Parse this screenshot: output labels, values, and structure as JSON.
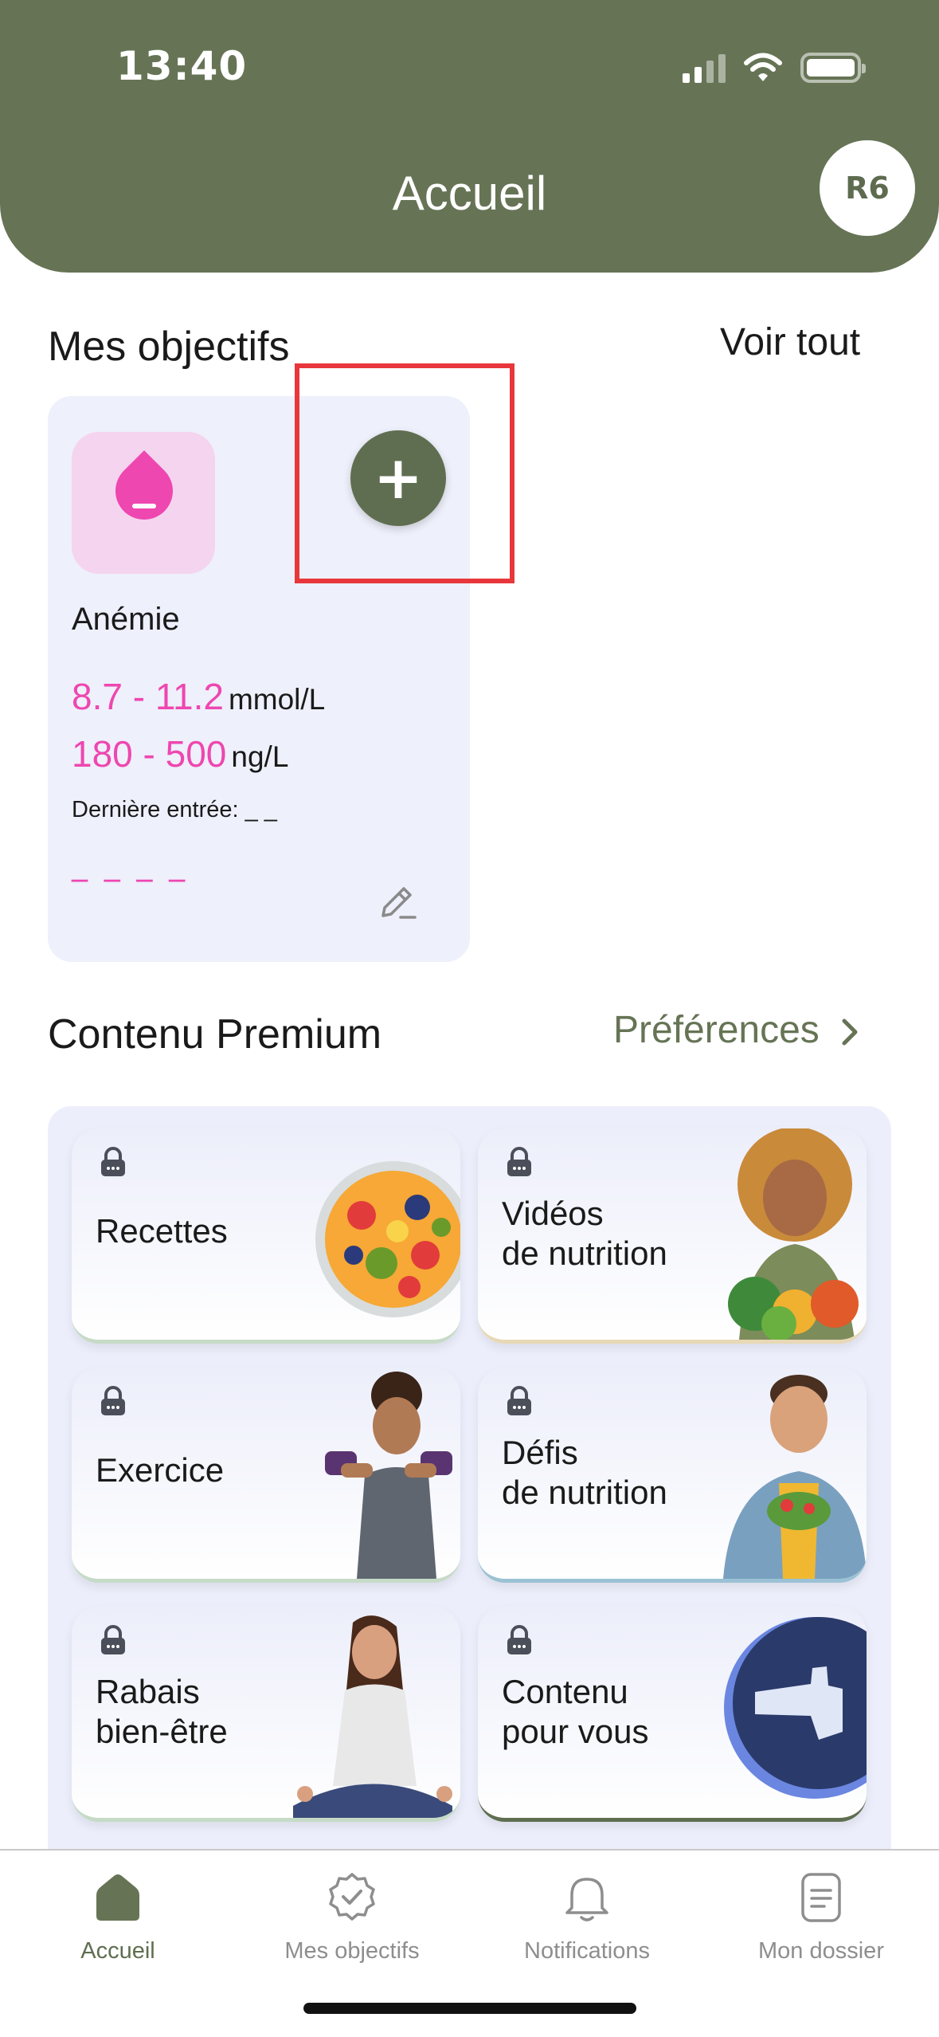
{
  "status_bar": {
    "time": "13:40"
  },
  "header": {
    "title": "Accueil",
    "avatar_initials": "R6"
  },
  "objectives": {
    "title": "Mes objectifs",
    "see_all": "Voir tout",
    "card": {
      "name": "Anémie",
      "icon": "blood-drop-minus-icon",
      "ranges": [
        {
          "value": "8.7 - 11.2",
          "unit": "mmol/L"
        },
        {
          "value": "180 - 500",
          "unit": "ng/L"
        }
      ],
      "last_entry": "Dernière entrée: _ _",
      "placeholder": "_ _ _ _"
    },
    "add_button": "+"
  },
  "premium": {
    "title": "Contenu Premium",
    "preferences": "Préférences",
    "tiles": [
      {
        "label": "Recettes",
        "icon": "lock-icon",
        "art": "fruit-bowl"
      },
      {
        "label": "Vidéos\nde nutrition",
        "icon": "lock-icon",
        "art": "woman-with-vegetables"
      },
      {
        "label": "Exercice",
        "icon": "lock-icon",
        "art": "woman-with-dumbbells"
      },
      {
        "label": "Défis\nde nutrition",
        "icon": "lock-icon",
        "art": "man-with-salad"
      },
      {
        "label": "Rabais\nbien-être",
        "icon": "lock-icon",
        "art": "woman-meditating"
      },
      {
        "label": "Contenu\npour vous",
        "icon": "lock-icon",
        "art": "pointing-hand-badge"
      }
    ]
  },
  "bottom_nav": [
    {
      "label": "Accueil",
      "icon": "home-icon",
      "active": true
    },
    {
      "label": "Mes objectifs",
      "icon": "badge-check-icon",
      "active": false
    },
    {
      "label": "Notifications",
      "icon": "bell-icon",
      "active": false
    },
    {
      "label": "Mon dossier",
      "icon": "document-icon",
      "active": false
    }
  ],
  "colors": {
    "brand": "#667455",
    "accent_pink": "#EE47B0",
    "highlight_red": "#E8373B"
  }
}
